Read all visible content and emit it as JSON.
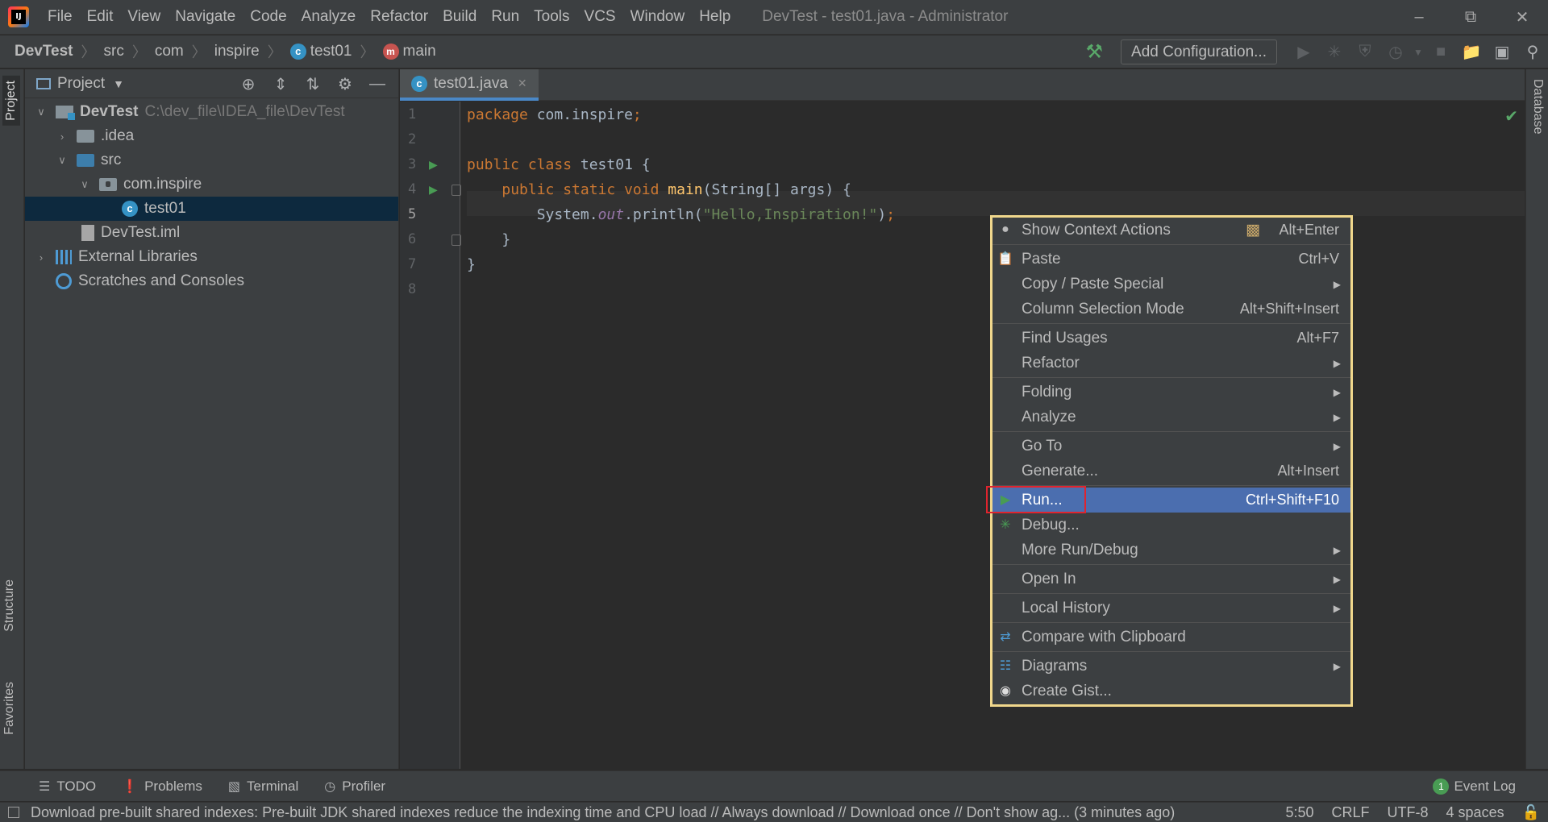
{
  "window": {
    "title": "DevTest - test01.java - Administrator",
    "menu": [
      "File",
      "Edit",
      "View",
      "Navigate",
      "Code",
      "Analyze",
      "Refactor",
      "Build",
      "Run",
      "Tools",
      "VCS",
      "Window",
      "Help"
    ]
  },
  "breadcrumbs": [
    "DevTest",
    "src",
    "com",
    "inspire",
    "test01",
    "main"
  ],
  "toolbar": {
    "add_configuration": "Add Configuration..."
  },
  "left_stripe": {
    "project": "Project",
    "structure": "Structure",
    "favorites": "Favorites"
  },
  "right_stripe": {
    "database": "Database"
  },
  "project_panel": {
    "title": "Project",
    "tree": [
      {
        "label": "DevTest",
        "path": "C:\\dev_file\\IDEA_file\\DevTest"
      },
      {
        "label": ".idea"
      },
      {
        "label": "src"
      },
      {
        "label": "com.inspire"
      },
      {
        "label": "test01"
      },
      {
        "label": "DevTest.iml"
      },
      {
        "label": "External Libraries"
      },
      {
        "label": "Scratches and Consoles"
      }
    ]
  },
  "editor": {
    "tab": "test01.java",
    "line_numbers": [
      "1",
      "2",
      "3",
      "4",
      "5",
      "6",
      "7",
      "8"
    ],
    "current_line": 5
  },
  "context_menu": {
    "items": [
      {
        "label": "Show Context Actions",
        "shortcut": "Alt+Enter",
        "icon": "bulb-icon"
      },
      {
        "label": "Paste",
        "shortcut": "Ctrl+V",
        "icon": "clipboard-icon"
      },
      {
        "label": "Copy / Paste Special",
        "shortcut": ""
      },
      {
        "label": "Column Selection Mode",
        "shortcut": "Alt+Shift+Insert"
      },
      {
        "label": "Find Usages",
        "shortcut": "Alt+F7"
      },
      {
        "label": "Refactor",
        "shortcut": ""
      },
      {
        "label": "Folding",
        "shortcut": ""
      },
      {
        "label": "Analyze",
        "shortcut": ""
      },
      {
        "label": "Go To",
        "shortcut": ""
      },
      {
        "label": "Generate...",
        "shortcut": "Alt+Insert"
      },
      {
        "label": "Run...",
        "shortcut": "Ctrl+Shift+F10",
        "icon": "run-icon"
      },
      {
        "label": "Debug...",
        "shortcut": "",
        "icon": "debug-icon"
      },
      {
        "label": "More Run/Debug",
        "shortcut": ""
      },
      {
        "label": "Open In",
        "shortcut": ""
      },
      {
        "label": "Local History",
        "shortcut": ""
      },
      {
        "label": "Compare with Clipboard",
        "shortcut": "",
        "icon": "compare-icon"
      },
      {
        "label": "Diagrams",
        "shortcut": "",
        "icon": "diagram-icon"
      },
      {
        "label": "Create Gist...",
        "shortcut": "",
        "icon": "github-icon"
      }
    ],
    "highlighted": "Run..."
  },
  "bottom_tools": [
    "TODO",
    "Problems",
    "Terminal",
    "Profiler"
  ],
  "event_log": {
    "label": "Event Log",
    "count": "1"
  },
  "status": {
    "message": "Download pre-built shared indexes: Pre-built JDK shared indexes reduce the indexing time and CPU load // Always download // Download once // Don't show ag... (3 minutes ago)",
    "position": "5:50",
    "line_separator": "CRLF",
    "encoding": "UTF-8",
    "indent": "4 spaces"
  },
  "colors": {
    "accent": "#4b6eaf",
    "menu_border": "#f0d78c",
    "annotation_box": "#e0242e",
    "run_green": "#499c54"
  }
}
